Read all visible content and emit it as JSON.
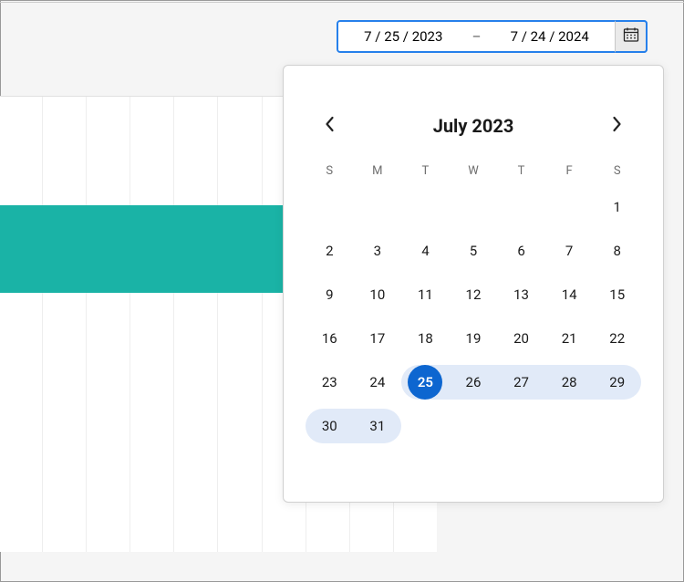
{
  "dateRange": {
    "start": "7 / 25 / 2023",
    "dash": "–",
    "end": "7 / 24 / 2024"
  },
  "calendar": {
    "title": "July 2023",
    "weekdays": [
      "S",
      "M",
      "T",
      "W",
      "T",
      "F",
      "S"
    ],
    "firstDayOffset": 6,
    "daysInMonth": 31,
    "selectedDay": 25,
    "rangeStart": 25,
    "rangeEnd": 31
  }
}
